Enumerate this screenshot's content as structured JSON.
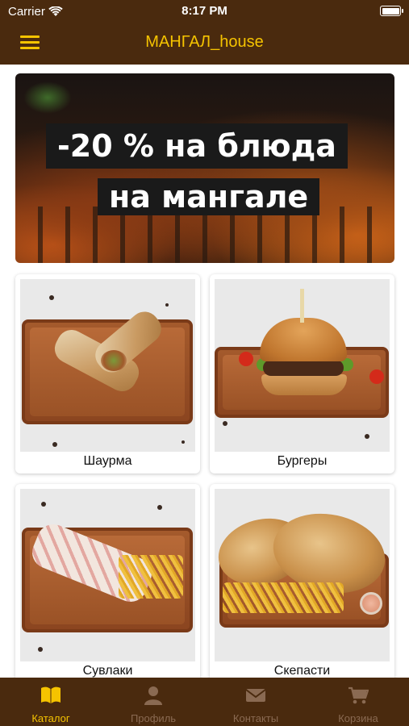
{
  "status_bar": {
    "carrier": "Carrier",
    "time": "8:17 PM"
  },
  "navbar": {
    "title": "МАНГАЛ_house",
    "menu_icon": "hamburger-menu-icon"
  },
  "banner": {
    "line1": "-20 % на блюда",
    "line2": "на мангале"
  },
  "categories": [
    {
      "label": "Шаурма"
    },
    {
      "label": "Бургеры"
    },
    {
      "label": "Сувлаки"
    },
    {
      "label": "Скепасти"
    }
  ],
  "tabbar": {
    "tabs": [
      {
        "label": "Каталог",
        "icon": "book-icon",
        "active": true
      },
      {
        "label": "Профиль",
        "icon": "person-icon",
        "active": false
      },
      {
        "label": "Контакты",
        "icon": "envelope-icon",
        "active": false
      },
      {
        "label": "Корзина",
        "icon": "cart-icon",
        "active": false
      }
    ]
  },
  "colors": {
    "brand_brown": "#4a2a0e",
    "accent_yellow": "#f5c300",
    "inactive_tab": "#8a6a52"
  }
}
